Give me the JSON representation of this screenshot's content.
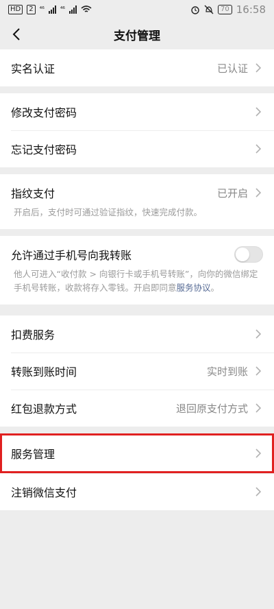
{
  "status_bar": {
    "badges": [
      "HD",
      "2"
    ],
    "signal_1": "⁴⁶",
    "signal_2": "⁴⁶",
    "battery": "70",
    "time": "16:58"
  },
  "header": {
    "title": "支付管理"
  },
  "groups": {
    "identity": {
      "label": "实名认证",
      "value": "已认证"
    },
    "password": {
      "change_label": "修改支付密码",
      "forget_label": "忘记支付密码"
    },
    "fingerprint": {
      "label": "指纹支付",
      "value": "已开启",
      "desc": "开启后，支付时可通过验证指纹，快速完成付款。"
    },
    "phone_transfer": {
      "label": "允许通过手机号向我转账",
      "desc": "他人可进入“收付款 > 向银行卡或手机号转账”，向你的微信绑定手机号转账，收款将存入零钱。开启即同意",
      "agreement_link": "服务协议",
      "desc_end": "。",
      "enabled": false
    },
    "services": {
      "deduction_label": "扣费服务",
      "transfer_time_label": "转账到账时间",
      "transfer_time_value": "实时到账",
      "red_packet_label": "红包退款方式",
      "red_packet_value": "退回原支付方式"
    },
    "management": {
      "service_mgmt_label": "服务管理",
      "cancel_label": "注销微信支付"
    }
  },
  "colors": {
    "highlight": "#e02020",
    "link": "#576b95",
    "background": "#ededed"
  }
}
